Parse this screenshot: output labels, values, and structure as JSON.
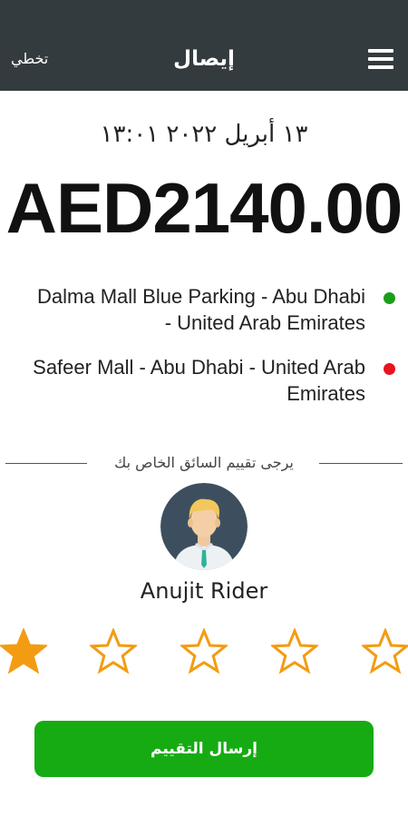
{
  "header": {
    "title": "إيصال",
    "skip_label": "تخطي",
    "menu_icon": "hamburger-menu-icon"
  },
  "receipt": {
    "date_time": "١٣ أبريل ٢٠٢٢ ١٣:٠١",
    "fare": "AED2140.00"
  },
  "route": {
    "pickup": "Dalma Mall Blue Parking - Abu Dhabi - United Arab Emirates",
    "dropoff": "Safeer Mall - Abu Dhabi - United Arab Emirates",
    "pickup_color": "#1a9e1a",
    "dropoff_color": "#e8141e"
  },
  "rating": {
    "prompt": "يرجى تقييم السائق الخاص بك",
    "driver_name": "Anujit Rider",
    "max_stars": 5,
    "selected_stars": 1,
    "star_color": "#f39c12"
  },
  "submit": {
    "label": "إرسال التقييم",
    "color": "#17ab13"
  },
  "colors": {
    "header_bg": "#343b3e"
  }
}
